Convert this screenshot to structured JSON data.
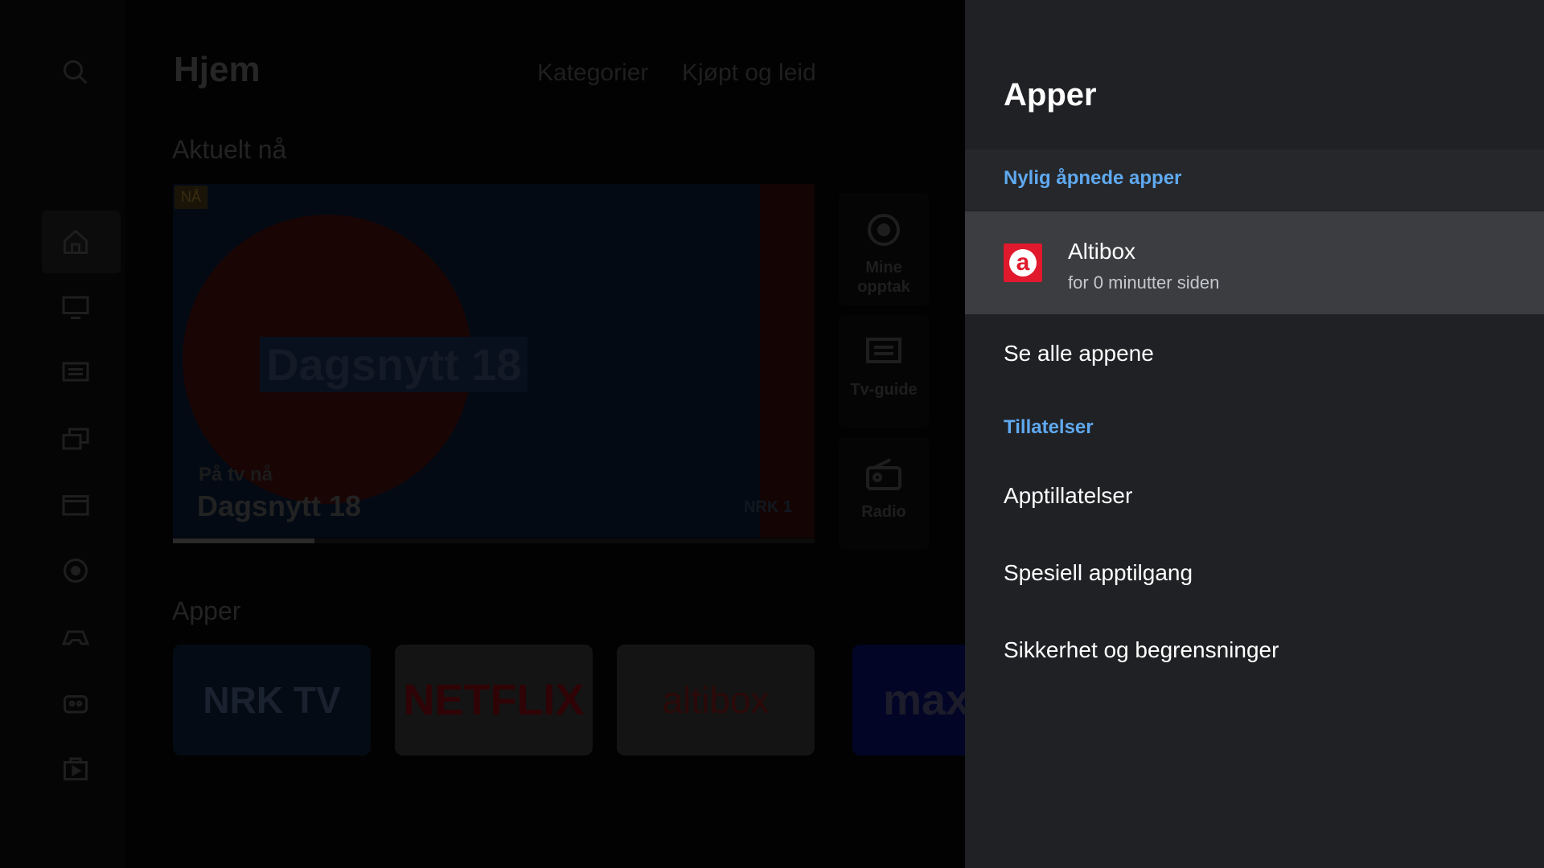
{
  "background": {
    "title": "Hjem",
    "nav_tabs": [
      "Kategorier",
      "Kjøpt og leid"
    ],
    "current_section": "Aktuelt nå",
    "hero": {
      "badge": "NÅ",
      "overlay_title": "Dagsnytt 18",
      "on_tv_label": "På tv nå",
      "show_title": "Dagsnytt 18",
      "channel": "NRK 1",
      "progress": 0.22
    },
    "quick_links": [
      {
        "icon": "record-icon",
        "line1": "Mine",
        "line2": "opptak"
      },
      {
        "icon": "tv-guide-icon",
        "line1": "Tv-guide",
        "line2": ""
      },
      {
        "icon": "radio-icon",
        "line1": "Radio",
        "line2": ""
      }
    ],
    "apps_section": "Apper",
    "apps": [
      {
        "label": "NRK TV",
        "bg": "#050b14",
        "fg": "#1a2230"
      },
      {
        "label": "NETFLIX",
        "bg": "#141414",
        "fg": "#300306"
      },
      {
        "label": "altibox",
        "bg": "#141414",
        "fg": "#2d0808"
      },
      {
        "label": "max",
        "bg": "#020526",
        "fg": "#1c1c2a"
      }
    ]
  },
  "panel": {
    "title": "Apper",
    "recent_header": "Nylig åpnede apper",
    "recent_app": {
      "name": "Altibox",
      "subtitle": "for 0 minutter siden",
      "icon_letter": "a",
      "color": "#e0192c"
    },
    "see_all": "Se alle appene",
    "permissions_header": "Tillatelser",
    "items": [
      "Apptillatelser",
      "Spesiell apptilgang",
      "Sikkerhet og begrensninger"
    ]
  },
  "colors": {
    "accent": "#5fa9f0",
    "panel_bg": "#202124",
    "selected_bg": "#3c3d40"
  }
}
